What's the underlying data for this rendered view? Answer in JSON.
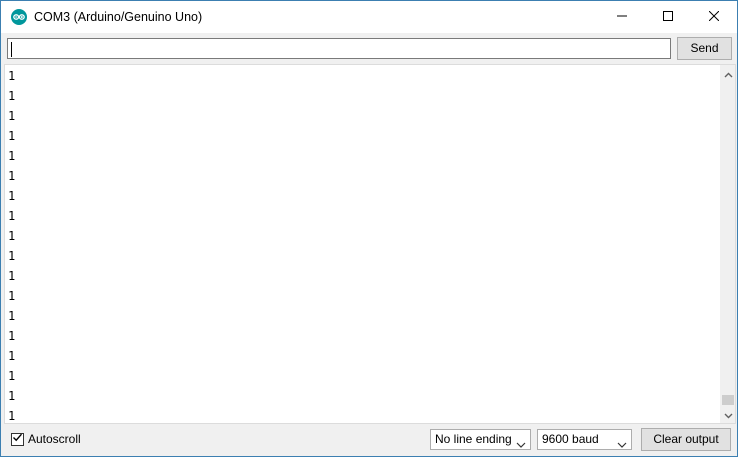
{
  "window": {
    "title": "COM3 (Arduino/Genuino Uno)",
    "app_icon": "arduino-icon",
    "controls": [
      "minimize-icon",
      "maximize-icon",
      "close-icon"
    ]
  },
  "send_row": {
    "input_value": "",
    "send_label": "Send"
  },
  "output": {
    "lines": [
      "1",
      "1",
      "1",
      "1",
      "1",
      "1",
      "1",
      "1",
      "1",
      "1",
      "1",
      "1",
      "1",
      "1",
      "1",
      "1",
      "1",
      "1"
    ]
  },
  "footer": {
    "autoscroll_label": "Autoscroll",
    "autoscroll_checked": true,
    "line_ending": "No line ending",
    "baud": "9600 baud",
    "clear_label": "Clear output"
  },
  "colors": {
    "window_border": "#3c7fb1",
    "chrome_bg": "#f0f0f0",
    "button_bg": "#e1e1e1",
    "arduino_teal": "#00979c"
  }
}
